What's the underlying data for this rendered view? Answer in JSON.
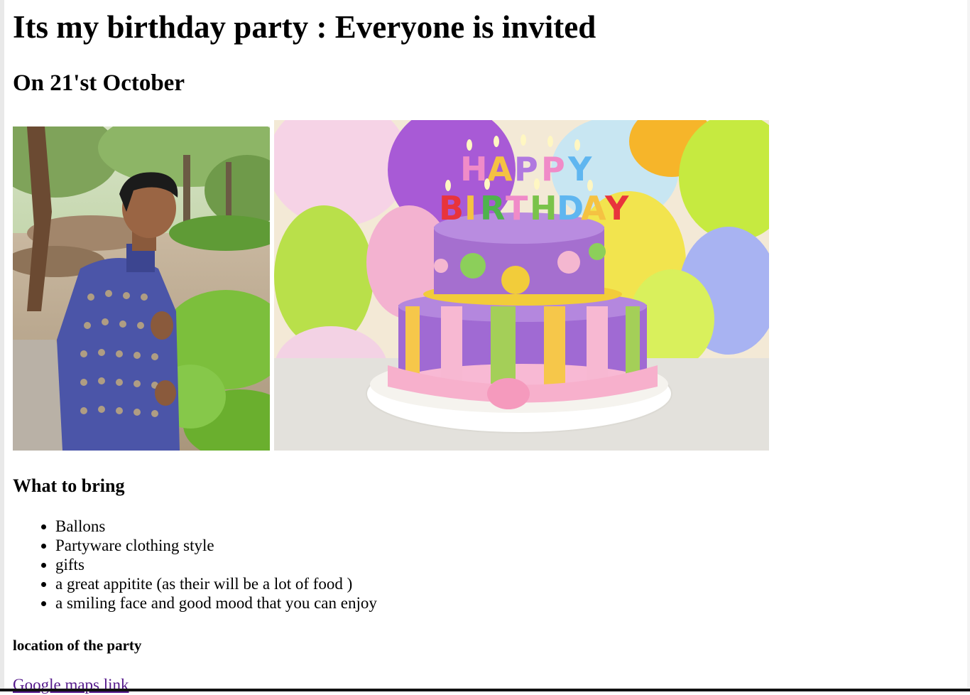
{
  "page": {
    "title": "Its my birthday party : Everyone is invited",
    "subtitle": "On 21'st October"
  },
  "images": {
    "person_photo": "photo-of-man-in-patterned-sherwani-in-park",
    "cake_photo": "happy-birthday-cake-with-candles-and-balloons"
  },
  "bring": {
    "heading": "What to bring",
    "items": [
      "Ballons",
      "Partyware clothing style",
      "gifts",
      "a great appitite (as their will be a lot of food )",
      "a smiling face and good mood that you can enjoy"
    ]
  },
  "location": {
    "heading": "location of the party",
    "link_label": "Google maps link"
  },
  "colors": {
    "link_visited": "#551a8b",
    "text": "#000000",
    "background": "#ffffff"
  }
}
